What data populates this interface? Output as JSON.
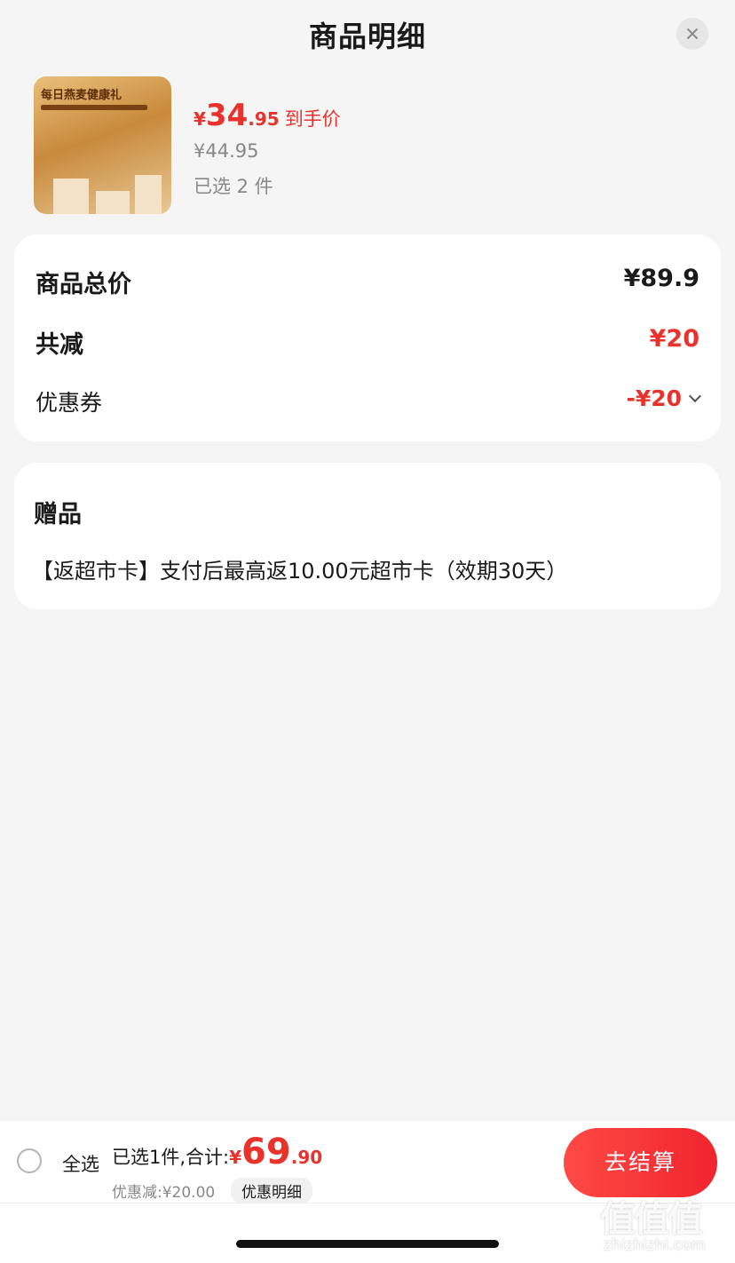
{
  "header": {
    "title": "商品明细"
  },
  "product": {
    "image_banner_text": "每日燕麦健康礼",
    "price_yen": "¥",
    "price_int": "34",
    "price_dec": ".95",
    "price_tag": "到手价",
    "original_price": "¥44.95",
    "selected_count": "已选 2 件"
  },
  "summary": {
    "total_label": "商品总价",
    "total_value": "¥89.9",
    "reduce_label": "共减",
    "reduce_value": "¥20",
    "coupon_label": "优惠券",
    "coupon_value": "-¥20"
  },
  "gift": {
    "title": "赠品",
    "description": "【返超市卡】支付后最高返10.00元超市卡（效期30天）"
  },
  "bottom_bar": {
    "select_all": "全选",
    "selected_total_text": "已选1件,合计:",
    "total_yen": "¥",
    "total_int": "69",
    "total_dec": ".90",
    "discount_text": "优惠减:¥20.00",
    "detail_chip": "优惠明细",
    "checkout": "去结算"
  },
  "watermark": {
    "big": "值值值",
    "small": "zhizhizhi.com"
  },
  "colors": {
    "accent_red": "#e8322b",
    "background": "#f5f5f5"
  },
  "icons": [
    "close-icon",
    "chevron-down-icon",
    "radio-unchecked-icon"
  ]
}
